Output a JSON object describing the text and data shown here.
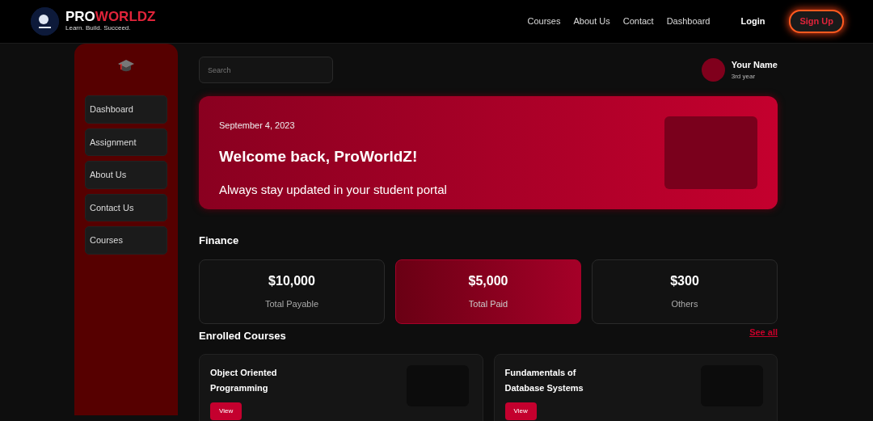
{
  "brand": {
    "name_start": "PRO",
    "name_end": "WORLDZ",
    "tagline": "Learn. Build. Succeed."
  },
  "nav": {
    "links": [
      "Courses",
      "About Us",
      "Contact",
      "Dashboard"
    ],
    "login": "Login",
    "signup": "Sign Up"
  },
  "sidebar": {
    "items": [
      "Dashboard",
      "Assignment",
      "About Us",
      "Contact Us",
      "Courses"
    ]
  },
  "search": {
    "placeholder": "Search"
  },
  "profile": {
    "name": "Your Name",
    "year": "3rd year"
  },
  "welcome": {
    "date": "September 4, 2023",
    "title": "Welcome back, ProWorldZ!",
    "subtitle": "Always stay updated in your student portal"
  },
  "finance": {
    "title": "Finance",
    "cards": [
      {
        "amount": "$10,000",
        "label": "Total Payable",
        "highlighted": false
      },
      {
        "amount": "$5,000",
        "label": "Total Paid",
        "highlighted": true
      },
      {
        "amount": "$300",
        "label": "Others",
        "highlighted": false
      }
    ]
  },
  "courses": {
    "title": "Enrolled Courses",
    "see_all": "See all",
    "items": [
      {
        "title_lines": [
          "Object Oriented",
          "Programming"
        ],
        "button": "View"
      },
      {
        "title_lines": [
          "Fundamentals of",
          "Database Systems"
        ],
        "button": "View"
      }
    ]
  }
}
